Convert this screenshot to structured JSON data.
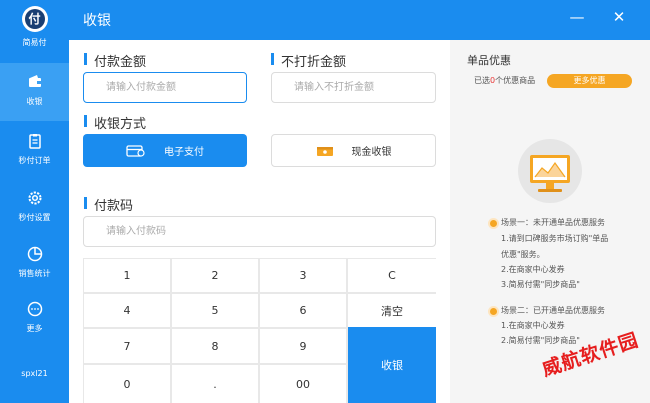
{
  "app": {
    "logo_text": "简易付",
    "logo_glyph": "付"
  },
  "sidebar": {
    "items": [
      {
        "label": "收银",
        "icon": "wallet-icon"
      },
      {
        "label": "秒付订单",
        "icon": "clipboard-icon"
      },
      {
        "label": "秒付设置",
        "icon": "gear-icon"
      },
      {
        "label": "销售统计",
        "icon": "pie-chart-icon"
      },
      {
        "label": "更多",
        "icon": "more-icon"
      }
    ],
    "user": "spxl21"
  },
  "header": {
    "title": "收银",
    "minimize": "—",
    "close": "✕"
  },
  "form": {
    "amount_label": "付款金额",
    "amount_placeholder": "请输入付款金额",
    "nodiscount_label": "不打折金额",
    "nodiscount_placeholder": "请输入不打折金额",
    "method_label": "收银方式",
    "method_electronic": "电子支付",
    "method_cash": "现金收银",
    "code_label": "付款码",
    "code_placeholder": "请输入付款码"
  },
  "keypad": {
    "keys": [
      "1",
      "2",
      "3",
      "C",
      "4",
      "5",
      "6",
      "清空",
      "7",
      "8",
      "9",
      "0",
      ".",
      "00"
    ],
    "submit": "收银"
  },
  "promo": {
    "title": "单品优惠",
    "count_prefix": "已选",
    "count_value": "0",
    "count_suffix": "个优惠商品",
    "more_button": "更多优惠",
    "scene1_title": "场景一：未开通单品优惠服务",
    "scene1_line1": "1.请到口碑服务市场订购\"单品",
    "scene1_line2": "优惠\"服务。",
    "scene1_line3": "2.在商家中心发券",
    "scene1_line4": "3.简易付需\"同步商品\"",
    "scene2_title": "场景二：已开通单品优惠服务",
    "scene2_line1": "1.在商家中心发券",
    "scene2_line2": "2.简易付需\"同步商品\""
  },
  "watermark": "威航软件园",
  "colors": {
    "primary": "#1a8cef",
    "accent": "#f5a623",
    "highlight": "#e83838"
  }
}
